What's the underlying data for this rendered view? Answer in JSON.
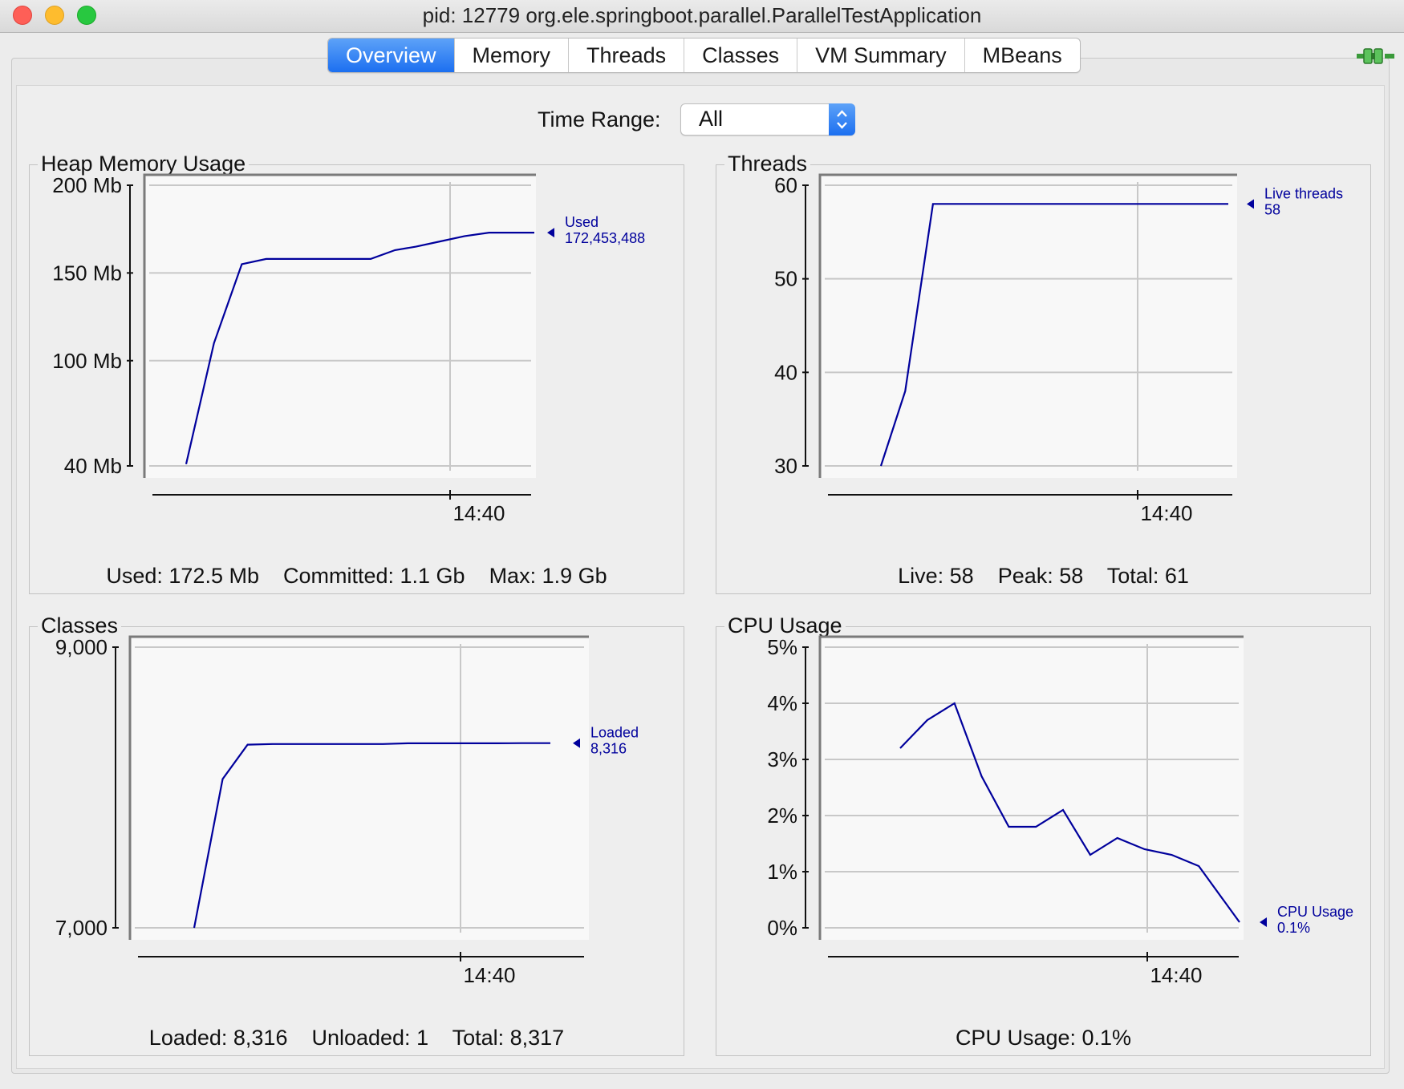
{
  "window": {
    "title": "pid: 12779 org.ele.springboot.parallel.ParallelTestApplication"
  },
  "tabs": [
    {
      "label": "Overview",
      "active": true
    },
    {
      "label": "Memory",
      "active": false
    },
    {
      "label": "Threads",
      "active": false
    },
    {
      "label": "Classes",
      "active": false
    },
    {
      "label": "VM Summary",
      "active": false
    },
    {
      "label": "MBeans",
      "active": false
    }
  ],
  "toolbar": {
    "connection_icon": "connected-plug-icon"
  },
  "time_range": {
    "label": "Time Range:",
    "value": "All"
  },
  "colors": {
    "accent": "#1c6ff0",
    "series": "#00009c",
    "plot_bg": "#f8f8f8"
  },
  "panels": {
    "heap": {
      "title": "Heap Memory Usage",
      "summary": "Used: 172.5 Mb    Committed: 1.1 Gb    Max: 1.9 Gb"
    },
    "threads": {
      "title": "Threads",
      "summary": "Live: 58    Peak: 58    Total: 61"
    },
    "classes": {
      "title": "Classes",
      "summary": "Loaded: 8,316    Unloaded: 1    Total: 8,317"
    },
    "cpu": {
      "title": "CPU Usage",
      "summary": "CPU Usage: 0.1%"
    }
  },
  "chart_data": [
    {
      "id": "heap",
      "type": "line",
      "title": "Heap Memory Usage",
      "y_ticks": [
        "200 Mb",
        "150 Mb",
        "100 Mb",
        "40 Mb"
      ],
      "y_tick_values": [
        200,
        150,
        100,
        40
      ],
      "ylim": [
        40,
        200
      ],
      "x_tick": "14:40",
      "series": [
        {
          "name": "Used",
          "current": "172,453,488",
          "values": [
            41,
            110,
            155,
            158,
            158,
            158,
            158,
            158,
            163,
            165,
            168,
            171,
            173,
            173,
            173
          ],
          "x_fraction": [
            0,
            0.08,
            0.16,
            0.23,
            0.32,
            0.42,
            0.5,
            0.53,
            0.6,
            0.66,
            0.73,
            0.8,
            0.87,
            0.93,
            1
          ]
        }
      ]
    },
    {
      "id": "threads",
      "type": "line",
      "title": "Threads",
      "y_ticks": [
        "60",
        "50",
        "40",
        "30"
      ],
      "y_tick_values": [
        60,
        50,
        40,
        30
      ],
      "ylim": [
        30,
        60
      ],
      "x_tick": "14:40",
      "series": [
        {
          "name": "Live threads",
          "current": "58",
          "values": [
            30,
            38,
            58,
            58,
            58,
            58,
            58
          ],
          "x_fraction": [
            0,
            0.07,
            0.15,
            0.4,
            0.7,
            0.9,
            1
          ]
        }
      ]
    },
    {
      "id": "classes",
      "type": "line",
      "title": "Classes",
      "y_ticks": [
        "9,000",
        "7,000"
      ],
      "y_tick_values": [
        9000,
        7000
      ],
      "ylim": [
        7000,
        9000
      ],
      "x_tick": "14:40",
      "series": [
        {
          "name": "Loaded",
          "current": "8,316",
          "values": [
            7000,
            8060,
            8305,
            8310,
            8310,
            8310,
            8310,
            8310,
            8315,
            8315,
            8315,
            8315,
            8316,
            8316
          ],
          "x_fraction": [
            0,
            0.08,
            0.15,
            0.22,
            0.3,
            0.4,
            0.5,
            0.53,
            0.6,
            0.7,
            0.8,
            0.85,
            0.92,
            1
          ]
        }
      ]
    },
    {
      "id": "cpu",
      "type": "line",
      "title": "CPU Usage",
      "y_ticks": [
        "5%",
        "4%",
        "3%",
        "2%",
        "1%",
        "0%"
      ],
      "y_tick_values": [
        5,
        4,
        3,
        2,
        1,
        0
      ],
      "ylim": [
        0,
        5
      ],
      "x_tick": "14:40",
      "series": [
        {
          "name": "CPU Usage",
          "current": "0.1%",
          "values": [
            3.2,
            3.7,
            4.0,
            2.7,
            1.8,
            1.8,
            2.1,
            1.3,
            1.6,
            1.4,
            1.3,
            1.1,
            0.1
          ],
          "x_fraction": [
            0,
            0.08,
            0.16,
            0.24,
            0.32,
            0.4,
            0.48,
            0.56,
            0.64,
            0.72,
            0.8,
            0.88,
            1
          ]
        }
      ]
    }
  ]
}
